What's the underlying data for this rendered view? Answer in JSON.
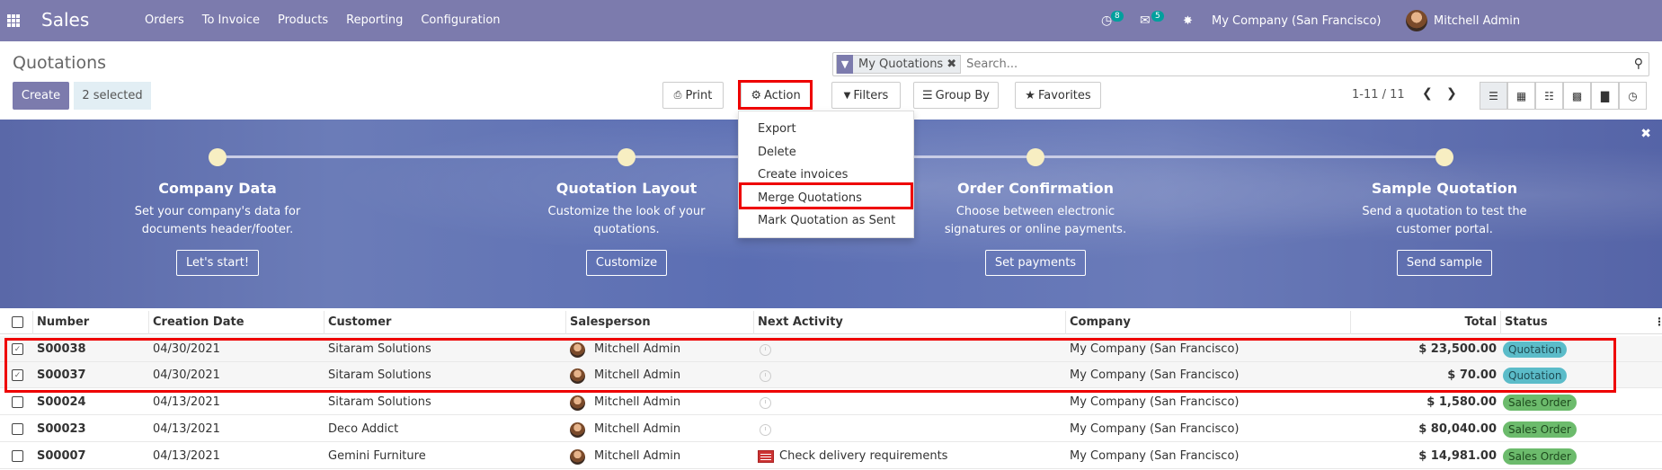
{
  "navbar": {
    "app": "Sales",
    "menu": [
      "Orders",
      "To Invoice",
      "Products",
      "Reporting",
      "Configuration"
    ],
    "activity_count": "8",
    "message_count": "5",
    "company": "My Company (San Francisco)",
    "user": "Mitchell Admin"
  },
  "control": {
    "title": "Quotations",
    "create": "Create",
    "selected": "2 selected",
    "print": "Print",
    "action": "Action",
    "filters": "Filters",
    "group_by": "Group By",
    "favorites": "Favorites",
    "facet": "My Quotations",
    "search_placeholder": "Search...",
    "pager": "1-11 / 11"
  },
  "action_menu": [
    "Export",
    "Delete",
    "Create invoices",
    "Merge Quotations",
    "Mark Quotation as Sent"
  ],
  "banner": {
    "steps": [
      {
        "title": "Company Data",
        "desc1": "Set your company's data for",
        "desc2": "documents header/footer.",
        "button": "Let's start!"
      },
      {
        "title": "Quotation Layout",
        "desc1": "Customize the look of your",
        "desc2": "quotations.",
        "button": "Customize"
      },
      {
        "title": "Order Confirmation",
        "desc1": "Choose between electronic",
        "desc2": "signatures or online payments.",
        "button": "Set payments"
      },
      {
        "title": "Sample Quotation",
        "desc1": "Send a quotation to test the",
        "desc2": "customer portal.",
        "button": "Send sample"
      }
    ]
  },
  "table": {
    "headers": {
      "number": "Number",
      "date": "Creation Date",
      "customer": "Customer",
      "salesperson": "Salesperson",
      "activity": "Next Activity",
      "company": "Company",
      "total": "Total",
      "status": "Status"
    },
    "rows": [
      {
        "number": "S00038",
        "date": "04/30/2021",
        "customer": "Sitaram Solutions",
        "salesperson": "Mitchell Admin",
        "activity": "",
        "company": "My Company (San Francisco)",
        "total": "$ 23,500.00",
        "status": "Quotation"
      },
      {
        "number": "S00037",
        "date": "04/30/2021",
        "customer": "Sitaram Solutions",
        "salesperson": "Mitchell Admin",
        "activity": "",
        "company": "My Company (San Francisco)",
        "total": "$ 70.00",
        "status": "Quotation"
      },
      {
        "number": "S00024",
        "date": "04/13/2021",
        "customer": "Sitaram Solutions",
        "salesperson": "Mitchell Admin",
        "activity": "",
        "company": "My Company (San Francisco)",
        "total": "$ 1,580.00",
        "status": "Sales Order"
      },
      {
        "number": "S00023",
        "date": "04/13/2021",
        "customer": "Deco Addict",
        "salesperson": "Mitchell Admin",
        "activity": "",
        "company": "My Company (San Francisco)",
        "total": "$ 80,040.00",
        "status": "Sales Order"
      },
      {
        "number": "S00007",
        "date": "04/13/2021",
        "customer": "Gemini Furniture",
        "salesperson": "Mitchell Admin",
        "activity": "Check delivery requirements",
        "company": "My Company (San Francisco)",
        "total": "$ 14,981.00",
        "status": "Sales Order"
      }
    ]
  },
  "icons": {
    "apps": "grid-icon",
    "activity": "clock-icon",
    "messages": "chat-icon",
    "debug": "bug-icon",
    "print": "printer-icon",
    "action": "gear-icon",
    "filter": "funnel-icon",
    "group": "bars-icon",
    "favorite": "star-icon"
  },
  "colors": {
    "brand": "#7c7bad",
    "quotation": "#5bbcc9",
    "sales_order": "#6cbb6c",
    "highlight": "#e00000"
  }
}
